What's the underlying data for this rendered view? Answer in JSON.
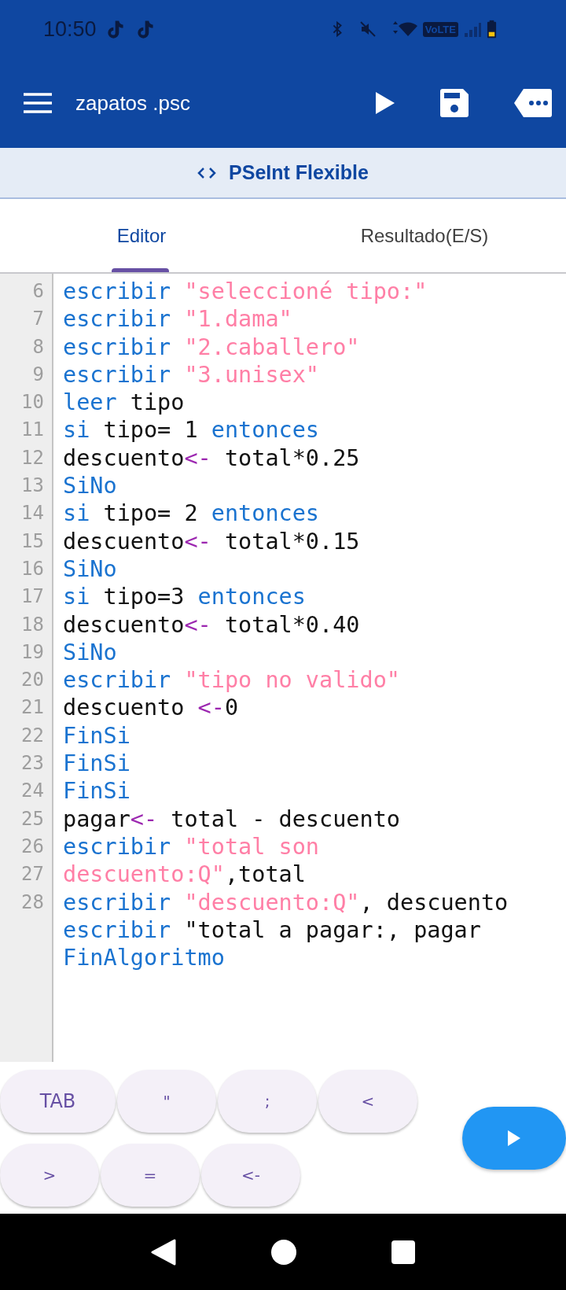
{
  "status_bar": {
    "time": "10:50",
    "network_badge": "VoLTE"
  },
  "app_bar": {
    "title": "zapatos .psc"
  },
  "mode_banner": {
    "label": "PSeInt Flexible"
  },
  "tabs": [
    {
      "label": "Editor",
      "selected": true
    },
    {
      "label": "Resultado(E/S)",
      "selected": false
    }
  ],
  "code_lines": [
    {
      "number": "6",
      "tokens": [
        {
          "kind": "keyword",
          "text": "escribir"
        },
        {
          "kind": "string",
          "text": " \"seleccioné tipo:\""
        }
      ]
    },
    {
      "number": "7",
      "tokens": [
        {
          "kind": "keyword",
          "text": "escribir"
        },
        {
          "kind": "string",
          "text": " \"1.dama\""
        }
      ]
    },
    {
      "number": "8",
      "tokens": [
        {
          "kind": "keyword",
          "text": "escribir"
        },
        {
          "kind": "string",
          "text": " \"2.caballero\""
        }
      ]
    },
    {
      "number": "9",
      "tokens": [
        {
          "kind": "keyword",
          "text": "escribir"
        },
        {
          "kind": "string",
          "text": " \"3.unisex\""
        }
      ]
    },
    {
      "number": "10",
      "tokens": [
        {
          "kind": "keyword",
          "text": "leer"
        },
        {
          "kind": "plain",
          "text": " tipo"
        }
      ]
    },
    {
      "number": "11",
      "tokens": [
        {
          "kind": "keyword",
          "text": "si"
        },
        {
          "kind": "plain",
          "text": " tipo= 1 "
        },
        {
          "kind": "keyword",
          "text": "entonces"
        }
      ]
    },
    {
      "number": "12",
      "tokens": [
        {
          "kind": "plain",
          "text": "descuento"
        },
        {
          "kind": "operator",
          "text": "<-"
        },
        {
          "kind": "plain",
          "text": " total*0.25"
        }
      ]
    },
    {
      "number": "13",
      "tokens": [
        {
          "kind": "keyword",
          "text": "SiNo"
        }
      ]
    },
    {
      "number": "14",
      "tokens": [
        {
          "kind": "keyword",
          "text": "si"
        },
        {
          "kind": "plain",
          "text": " tipo= 2 "
        },
        {
          "kind": "keyword",
          "text": "entonces"
        }
      ]
    },
    {
      "number": "15",
      "tokens": [
        {
          "kind": "plain",
          "text": "descuento"
        },
        {
          "kind": "operator",
          "text": "<-"
        },
        {
          "kind": "plain",
          "text": " total*0.15"
        }
      ]
    },
    {
      "number": "16",
      "tokens": [
        {
          "kind": "keyword",
          "text": "SiNo"
        }
      ]
    },
    {
      "number": "17",
      "tokens": [
        {
          "kind": "keyword",
          "text": "si"
        },
        {
          "kind": "plain",
          "text": " tipo=3 "
        },
        {
          "kind": "keyword",
          "text": "entonces"
        }
      ]
    },
    {
      "number": "18",
      "tokens": [
        {
          "kind": "plain",
          "text": "descuento"
        },
        {
          "kind": "operator",
          "text": "<-"
        },
        {
          "kind": "plain",
          "text": " total*0.40"
        }
      ]
    },
    {
      "number": "19",
      "tokens": [
        {
          "kind": "keyword",
          "text": "SiNo"
        }
      ]
    },
    {
      "number": "20",
      "tokens": [
        {
          "kind": "keyword",
          "text": "escribir"
        },
        {
          "kind": "string",
          "text": " \"tipo no valido\""
        }
      ]
    },
    {
      "number": "21",
      "tokens": [
        {
          "kind": "plain",
          "text": "descuento "
        },
        {
          "kind": "operator",
          "text": "<-"
        },
        {
          "kind": "plain",
          "text": "0"
        }
      ]
    },
    {
      "number": "22",
      "tokens": [
        {
          "kind": "keyword",
          "text": "FinSi"
        }
      ]
    },
    {
      "number": "23",
      "tokens": [
        {
          "kind": "keyword",
          "text": "FinSi"
        }
      ]
    },
    {
      "number": "24",
      "tokens": [
        {
          "kind": "keyword",
          "text": "FinSi"
        }
      ]
    },
    {
      "number": "25",
      "tokens": [
        {
          "kind": "plain",
          "text": "pagar"
        },
        {
          "kind": "operator",
          "text": "<-"
        },
        {
          "kind": "plain",
          "text": " total - descuento"
        }
      ]
    },
    {
      "number": "26",
      "tokens": [
        {
          "kind": "keyword",
          "text": "escribir"
        },
        {
          "kind": "string",
          "text": " \"total son"
        }
      ]
    },
    {
      "number": "27",
      "tokens": [
        {
          "kind": "string",
          "text": "descuento:Q\""
        },
        {
          "kind": "plain",
          "text": ",total"
        }
      ]
    },
    {
      "number": "28",
      "tokens": [
        {
          "kind": "keyword",
          "text": "escribir"
        },
        {
          "kind": "string",
          "text": " \"descuento:Q\""
        },
        {
          "kind": "plain",
          "text": ", descuento"
        }
      ]
    },
    {
      "tokens": [
        {
          "kind": "keyword",
          "text": "escribir"
        },
        {
          "kind": "plain",
          "text": " \"total a pagar:, pagar"
        }
      ]
    },
    {
      "tokens": [
        {
          "kind": "keyword",
          "text": "FinAlgoritmo"
        }
      ]
    }
  ],
  "symbol_keys": [
    [
      "TAB",
      "\"",
      ";",
      "<"
    ],
    [
      ">",
      "=",
      "<-"
    ]
  ]
}
